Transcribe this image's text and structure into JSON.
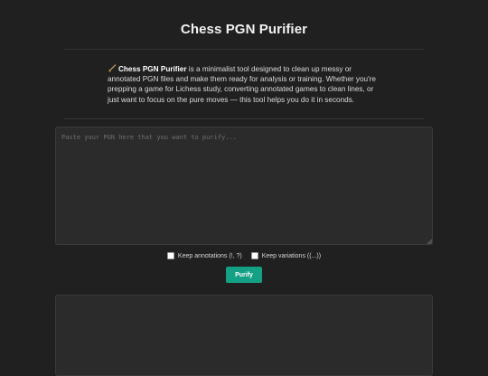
{
  "header": {
    "title": "Chess PGN Purifier"
  },
  "intro": {
    "emoji": "broom-icon",
    "app_name": "Chess PGN Purifier",
    "text": " is a minimalist tool designed to clean up messy or annotated PGN files and make them ready for analysis or training. Whether you're prepping a game for Lichess study, converting annotated games to clean lines, or just want to focus on the pure moves — this tool helps you do it in seconds."
  },
  "input": {
    "placeholder": "Paste your PGN here that you want to purify...",
    "value": ""
  },
  "options": {
    "keep_annotations": {
      "label": "Keep annotations (!, ?)",
      "checked": false
    },
    "keep_variations": {
      "label": "Keep variations ((...))",
      "checked": false
    }
  },
  "actions": {
    "purify_label": "Purify"
  },
  "output": {
    "value": ""
  },
  "colors": {
    "background": "#202020",
    "panel": "#2b2b2b",
    "accent": "#14a085"
  }
}
